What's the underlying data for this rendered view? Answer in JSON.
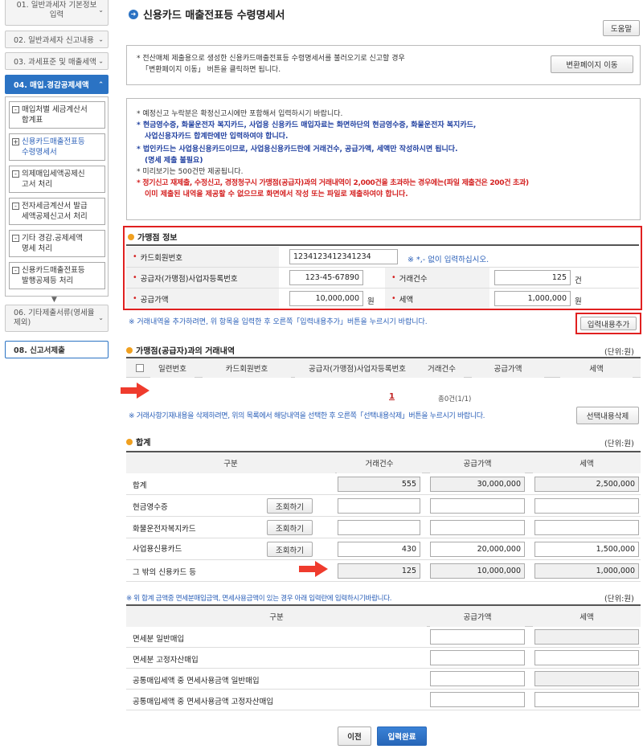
{
  "sidebar": {
    "items": [
      {
        "label": "01. 일반과세자 기본정보\n입력"
      },
      {
        "label": "02. 일반과세자 신고내용"
      },
      {
        "label": "03. 과세표준 및 매출세액"
      },
      {
        "label": "04. 매입.경감공제세액"
      },
      {
        "label": "06. 기타제출서류(영세율\n제외)"
      },
      {
        "label": "08. 신고서제출"
      }
    ],
    "sub": [
      {
        "icon": "-",
        "label": "매입처별 세금계산서\n합계표"
      },
      {
        "icon": "+",
        "label": "신용카드매출전표등\n수령명세서"
      },
      {
        "icon": "-",
        "label": "의제매입세액공제신\n고서 처리"
      },
      {
        "icon": "-",
        "label": "전자세금계산서 발급\n세액공제신고서 처리"
      },
      {
        "icon": "-",
        "label": "기타 경감.공제세액\n명세 처리"
      },
      {
        "icon": "-",
        "label": "신용카드매출전표등\n발행공제등 처리"
      }
    ]
  },
  "page": {
    "title": "신용카드 매출전표등 수령명세서",
    "help": "도움말"
  },
  "convert": {
    "text1": "* 전산매체 제출용으로 생성한 신용카드매출전표등 수령명세서를 불러오기로 신고할 경우",
    "text2": "「변환페이지 이동」 버튼을 클릭하면 됩니다.",
    "button": "변환페이지 이동"
  },
  "notice": {
    "l1": "* 예정신고 누락분은 확정신고시에만 포함해서 입력하시기 바랍니다.",
    "l2": "* 현금영수증, 화물운전자 복지카드, 사업용 신용카드 매입자료는 화면하단의 현금영수증, 화물운전자 복지카드,",
    "l3": "사업신용자카드 합계란에만 입력하여야 합니다.",
    "l4": "* 법인카드는 사업용신용카드이므로, 사업용신용카드란에 거래건수, 공급가액, 세액만 작성하시면 됩니다.",
    "l5": "(명세 제출 불필요)",
    "l6": "* 미리보기는 500건만 제공됩니다.",
    "l7": "* 정기신고 재제출, 수정신고, 경정청구시 가맹점(공급자)과의 거래내역이 2,000건을 초과하는 경우에는(파일 제출건은 200건 초과)",
    "l8": "이미 제출된 내역을 제공할 수 없으므로 화면에서 작성 또는 파일로 제출하여야 합니다."
  },
  "merchant": {
    "title": "가맹점 정보",
    "card_label": "카드회원번호",
    "card_value": "1234123412341234",
    "card_hint": "※ *,- 없이 입력하십시오.",
    "bizno_label": "공급자(가맹점)사업자등록번호",
    "bizno_value": "123-45-67890",
    "count_label": "거래건수",
    "count_value": "125",
    "count_unit": "건",
    "supply_label": "공급가액",
    "supply_value": "10,000,000",
    "supply_unit": "원",
    "tax_label": "세액",
    "tax_value": "1,000,000",
    "tax_unit": "원",
    "add_hint": "※ 거래내역을 추가하려면, 위 항목을 입력한 후 오른쪽「입력내용추가」버튼을 누르시기 바랍니다.",
    "add_button": "입력내용추가"
  },
  "history": {
    "title": "가맹점(공급자)과의 거래내역",
    "unit": "(단위:원)",
    "headers": [
      "일련번호",
      "카드회원번호",
      "공급자(가맹점)사업자등록번호",
      "거래건수",
      "공급가액",
      "세액"
    ],
    "page": "1",
    "total": "총0건(1/1)",
    "delete_hint": "※ 거래사항기재내용을 삭제하려면, 위의 목록에서 해당내역을 선택한 후 오른쪽「선택내용삭제」버튼을 누르시기 바랍니다.",
    "delete_button": "선택내용삭제"
  },
  "totals": {
    "title": "합계",
    "unit": "(단위:원)",
    "headers": [
      "구분",
      "거래건수",
      "공급가액",
      "세액"
    ],
    "rows": [
      {
        "label": "합계",
        "count": "555",
        "supply": "30,000,000",
        "tax": "2,500,000"
      },
      {
        "label": "현금영수증",
        "button": "조회하기",
        "count": "",
        "supply": "",
        "tax": ""
      },
      {
        "label": "화물운전자복지카드",
        "button": "조회하기",
        "count": "",
        "supply": "",
        "tax": ""
      },
      {
        "label": "사업용신용카드",
        "button": "조회하기",
        "count": "430",
        "supply": "20,000,000",
        "tax": "1,500,000"
      },
      {
        "label": "그 밖의 신용카드 등",
        "count": "125",
        "supply": "10,000,000",
        "tax": "1,000,000"
      }
    ]
  },
  "exempt": {
    "hint": "※ 위 합계 금액중 면세분매입금액, 면세사용금액이 있는 경우 아래 입력란에 입력하시기바랍니다.",
    "unit": "(단위:원)",
    "headers": [
      "구분",
      "공급가액",
      "세액"
    ],
    "rows": [
      "면세분 일반매입",
      "면세분 고정자산매입",
      "공통매입세액 중 면세사용금액 일반매입",
      "공통매입세액 중 면세사용금액 고정자산매입"
    ]
  },
  "footer": {
    "prev": "이전",
    "done": "입력완료"
  },
  "colors": {
    "accent": "#2b73c4",
    "alert": "#e02020",
    "arrow": "#ef3b2d"
  }
}
